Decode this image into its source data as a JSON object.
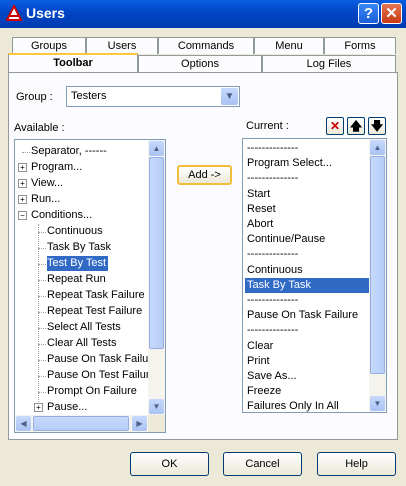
{
  "window": {
    "title": "Users",
    "help_label": "?",
    "close_label": "✕"
  },
  "tabs": {
    "row1": [
      "Groups",
      "Users",
      "Commands",
      "Menu",
      "Forms"
    ],
    "row2": [
      "Toolbar",
      "Options",
      "Log Files"
    ],
    "active": "Toolbar"
  },
  "group": {
    "label": "Group :",
    "value": "Testers"
  },
  "available": {
    "label": "Available :",
    "items": [
      {
        "label": "Separator, ------"
      },
      {
        "label": "Program..."
      },
      {
        "label": "View..."
      },
      {
        "label": "Run..."
      },
      {
        "label": "Conditions..."
      },
      {
        "label": "Continuous"
      },
      {
        "label": "Task By Task"
      },
      {
        "label": "Test By Test",
        "selected": true
      },
      {
        "label": "Repeat Run"
      },
      {
        "label": "Repeat Task Failure"
      },
      {
        "label": "Repeat Test Failure"
      },
      {
        "label": "Select All Tests"
      },
      {
        "label": "Clear All Tests"
      },
      {
        "label": "Pause On Task Failure"
      },
      {
        "label": "Pause On Test Failure"
      },
      {
        "label": "Prompt On Failure"
      },
      {
        "label": "Pause..."
      }
    ]
  },
  "add_button": "Add ->",
  "current": {
    "label": "Current :",
    "items": [
      {
        "label": "--------------"
      },
      {
        "label": "Program Select..."
      },
      {
        "label": "--------------"
      },
      {
        "label": "Start"
      },
      {
        "label": "Reset"
      },
      {
        "label": "Abort"
      },
      {
        "label": "Continue/Pause"
      },
      {
        "label": "--------------"
      },
      {
        "label": "Continuous"
      },
      {
        "label": "Task By Task",
        "selected": true
      },
      {
        "label": "--------------"
      },
      {
        "label": "Pause On Task Failure"
      },
      {
        "label": "--------------"
      },
      {
        "label": "Clear"
      },
      {
        "label": "Print"
      },
      {
        "label": "Save As..."
      },
      {
        "label": "Freeze"
      },
      {
        "label": "Failures Only In All"
      }
    ],
    "remove_icon": "red-x-icon",
    "up_icon": "arrow-up-icon",
    "down_icon": "arrow-down-icon"
  },
  "buttons": {
    "ok": "OK",
    "cancel": "Cancel",
    "help": "Help"
  }
}
